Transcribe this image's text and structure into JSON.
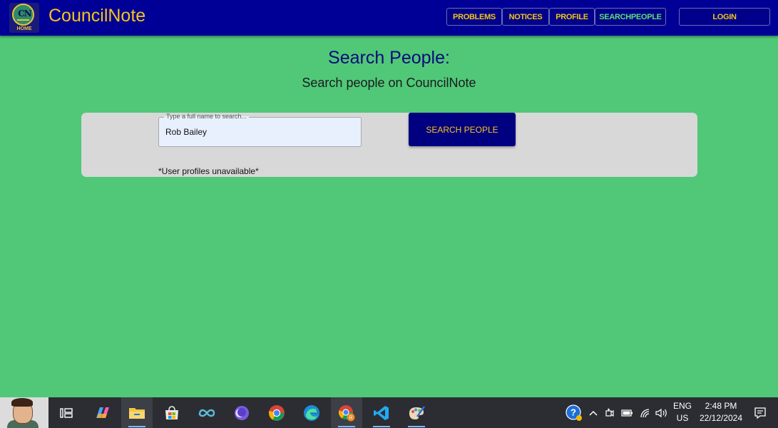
{
  "header": {
    "brand": "CouncilNote",
    "logo": {
      "text": "CN",
      "caption": "HOME"
    },
    "nav": [
      {
        "label": "PROBLEMS",
        "active": false
      },
      {
        "label": "NOTICES",
        "active": false
      },
      {
        "label": "PROFILE",
        "active": false
      },
      {
        "label": "SEARCHPEOPLE",
        "active": true
      }
    ],
    "login_label": "LOGIN"
  },
  "main": {
    "title": "Search People:",
    "subtitle": "Search people on CouncilNote",
    "search": {
      "legend": "Type a full name to search...",
      "value": "Rob Bailey",
      "button_label": "SEARCH PEOPLE"
    },
    "note": "*User profiles unavailable*"
  },
  "taskbar": {
    "apps": [
      "task-view",
      "copilot",
      "file-explorer",
      "microsoft-store",
      "meta-app",
      "purple-app",
      "chrome",
      "edge",
      "chrome-profile",
      "vscode",
      "paint"
    ],
    "lang_primary": "ENG",
    "lang_secondary": "US",
    "time": "2:48 PM",
    "date": "22/12/2024"
  },
  "colors": {
    "background": "#50c878",
    "header": "#000096",
    "accent": "#f5c518",
    "active_nav": "#5ee07a",
    "button": "#000080"
  }
}
